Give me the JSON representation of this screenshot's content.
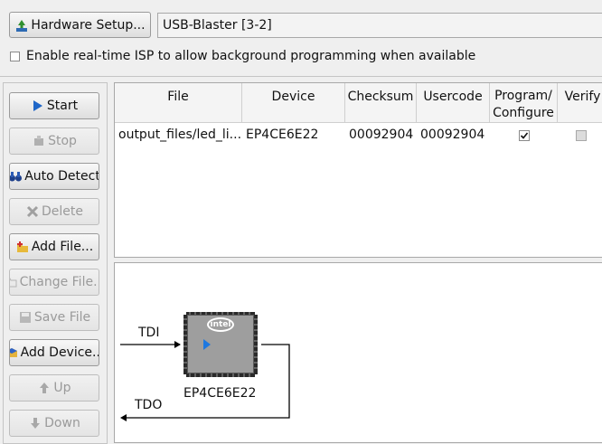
{
  "top": {
    "hardware_setup_label": "Hardware Setup...",
    "hardware_value": "USB-Blaster [3-2]",
    "isp_label": "Enable real-time ISP to allow background programming when available",
    "isp_checked": false
  },
  "sidebar": {
    "start": "Start",
    "stop": "Stop",
    "auto_detect": "Auto Detect",
    "delete": "Delete",
    "add_file": "Add File...",
    "change_file": "Change File...",
    "save_file": "Save File",
    "add_device": "Add Device...",
    "up": "Up",
    "down": "Down"
  },
  "table": {
    "headers": {
      "file": "File",
      "device": "Device",
      "checksum": "Checksum",
      "usercode": "Usercode",
      "program_1": "Program/",
      "program_2": "Configure",
      "verify": "Verify"
    },
    "rows": [
      {
        "file": "output_files/led_li...",
        "device": "EP4CE6E22",
        "checksum": "00092904",
        "usercode": "00092904",
        "program": true,
        "verify": false
      }
    ]
  },
  "diagram": {
    "tdi": "TDI",
    "tdo": "TDO",
    "chip_name": "EP4CE6E22",
    "chip_logo": "intel"
  }
}
